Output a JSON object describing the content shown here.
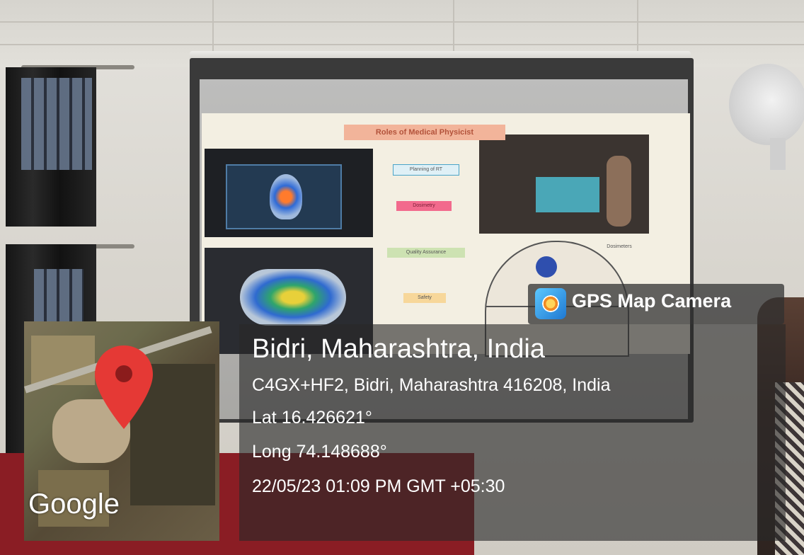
{
  "photo": {
    "slide_title": "Roles of Medical Physicist",
    "slide_tags": [
      "Planning of RT",
      "Dosimetry",
      "Quality Assurance",
      "Safety"
    ],
    "slide_circle_label": "Dosimeters"
  },
  "overlay": {
    "app_badge": {
      "icon": "gps-map-camera-icon",
      "label": "GPS Map Camera"
    },
    "map": {
      "provider_label": "Google",
      "pin_icon": "map-pin-icon"
    },
    "location_title": "Bidri, Maharashtra, India",
    "address": "C4GX+HF2, Bidri, Maharashtra 416208, India",
    "latitude": "Lat 16.426621°",
    "longitude": "Long 74.148688°",
    "timestamp": "22/05/23 01:09 PM GMT +05:30"
  },
  "colors": {
    "pin": "#e53935",
    "overlay_bg": "#282828",
    "badge_icon": "#1f78d1"
  }
}
